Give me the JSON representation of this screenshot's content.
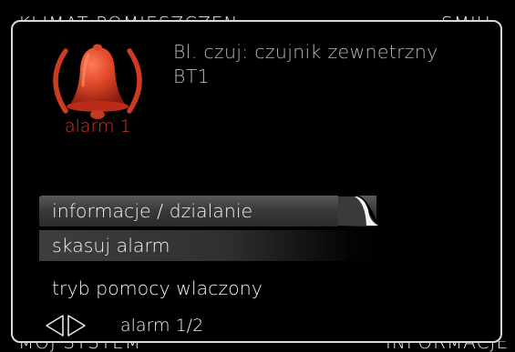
{
  "background_screen": {
    "top_left_text": "KLIMAT POMIESZCZEN",
    "top_right_text": "SMIU",
    "bottom_left_text": "MOJ SYSTEM",
    "bottom_right_text": "INFORMACJE"
  },
  "alarm": {
    "icon": "alarm-bell-icon",
    "label": "alarm 1",
    "message_line1": "Bl. czuj: czujnik zewnetrzny",
    "message_line2": "BT1",
    "color": "#d93a26"
  },
  "menu": {
    "items": [
      {
        "label": "informacje / dzialanie",
        "selected": true
      },
      {
        "label": "skasuj alarm"
      },
      {
        "label": "tryb pomocy wlaczony"
      }
    ]
  },
  "pager": {
    "icon": "left-right-arrows-icon",
    "label": "alarm 1/2"
  }
}
